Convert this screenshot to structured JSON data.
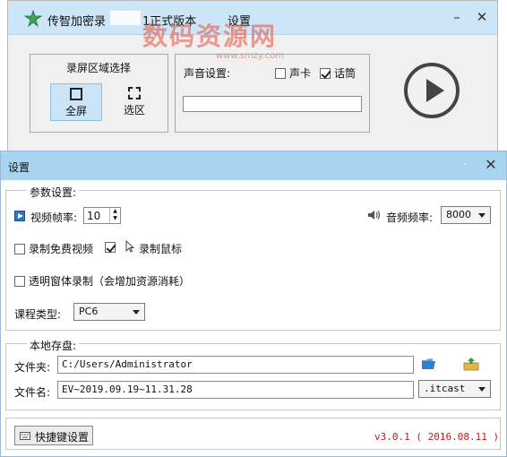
{
  "main_window": {
    "title_prefix": "传智加密录",
    "title_suffix": "1正式版本",
    "settings_label": "设置",
    "minimize_icon": "minimize-icon",
    "close_icon": "close-icon",
    "watermark": "数码资源网",
    "watermark_url": "www.smzy.com",
    "area_group_title": "录屏区域选择",
    "fullscreen_label": "全屏",
    "region_label": "选区",
    "sound_label": "声音设置:",
    "sound_card_label": "声卡",
    "mic_label": "话筒",
    "sound_card_checked": false,
    "mic_checked": true
  },
  "dialog": {
    "title": "设置",
    "params_group_title": "参数设置:",
    "fps_label": "视频帧率:",
    "fps_value": "10",
    "audio_rate_label": "音频频率:",
    "audio_rate_value": "8000",
    "free_video_label": "录制免费视频",
    "free_video_checked": false,
    "record_cursor_label": "录制鼠标",
    "record_cursor_checked": true,
    "transparent_label": "透明窗体录制（会增加资源消耗）",
    "transparent_checked": false,
    "course_type_label": "课程类型:",
    "course_type_value": "PC6",
    "storage_group_title": "本地存盘:",
    "folder_label": "文件夹:",
    "folder_value": "C:/Users/Administrator",
    "filename_label": "文件名:",
    "filename_value": "EV~2019.09.19~11.31.28",
    "extension_value": ".itcast",
    "shortcut_button": "快捷键设置",
    "version": "v3.0.1  ( 2016.08.11 )"
  },
  "colors": {
    "title_bar": "#a8d3f1",
    "version_text": "#cc1818",
    "selected_area": "#cce4f7"
  }
}
